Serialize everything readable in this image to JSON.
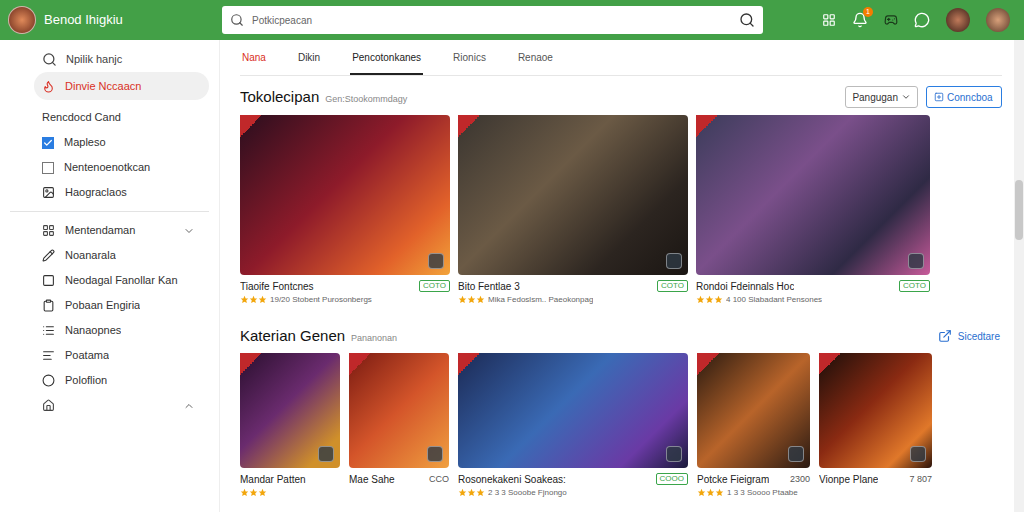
{
  "app": {
    "title": "Benod Ihigkiu"
  },
  "search": {
    "placeholder": "Potkicpeacan"
  },
  "notifications": {
    "count": "1"
  },
  "sidebar": {
    "items": [
      {
        "kind": "search",
        "label": "Npilik hanjc"
      },
      {
        "kind": "link",
        "label": "Dinvie Nccaacn",
        "selected": true
      },
      {
        "kind": "heading",
        "label": "Rencdocd Cand"
      },
      {
        "kind": "checkbox",
        "label": "Mapleso",
        "checked": true
      },
      {
        "kind": "checkbox",
        "label": "Nentenoenotkcan",
        "checked": false
      },
      {
        "kind": "link",
        "label": "Haograclaos",
        "selected": false
      },
      {
        "kind": "divider"
      },
      {
        "kind": "group",
        "label": "Mentendaman",
        "expanded": false
      },
      {
        "kind": "link",
        "label": "Noanarala",
        "selected": false
      },
      {
        "kind": "link",
        "label": "Neodagal Fanollar Kan",
        "selected": false
      },
      {
        "kind": "link",
        "label": "Pobaan Engiria",
        "selected": false
      },
      {
        "kind": "link",
        "label": "Nanaopnes",
        "selected": false
      },
      {
        "kind": "link",
        "label": "Poatama",
        "selected": false
      },
      {
        "kind": "link",
        "label": "Poloflion",
        "selected": false
      },
      {
        "kind": "group",
        "label": "",
        "expanded": true
      }
    ]
  },
  "tabs": [
    {
      "label": "Nana",
      "selected": false,
      "color": "#d93025"
    },
    {
      "label": "Dikin",
      "selected": false,
      "color": "#333333"
    },
    {
      "label": "Pencotonkanes",
      "selected": true,
      "color": "#222222"
    },
    {
      "label": "Rionics",
      "selected": false,
      "color": "#555555"
    },
    {
      "label": "Renaoe",
      "selected": false,
      "color": "#555555"
    }
  ],
  "sections": [
    {
      "title": "Tokolecipan",
      "subtitle": "Gen:Stookommdagy",
      "dropdown": "Pangugan",
      "button": "Conncboa",
      "link": "",
      "cards": [
        {
          "title": "Tiaoife Fontcnes",
          "price": "COTO",
          "kind": "badge",
          "stars": 3,
          "meta": "19/20 Stobent Purosonbergs"
        },
        {
          "title": "Bito Fentlae 3",
          "price": "COTO",
          "kind": "badge",
          "stars": 3,
          "meta": "Mika Fedoslsm.. Paeokonpag"
        },
        {
          "title": "Rondoi Fdeinnals Hoc",
          "price": "COTO",
          "kind": "badge",
          "stars": 3,
          "meta": "4 100 Slabadant Pensones"
        }
      ]
    },
    {
      "title": "Katerian Genen",
      "subtitle": "Pananonan",
      "dropdown": "",
      "button": "",
      "link": "Sicedtare",
      "cards": [
        {
          "title": "Mandar Patten",
          "price": "",
          "kind": "plain",
          "stars": 3,
          "meta": ""
        },
        {
          "title": "Mae Sahe",
          "price": "CCO",
          "kind": "plain",
          "stars": 0,
          "meta": ""
        },
        {
          "title": "Rosonekakeni Soakeas:",
          "price": "COOO",
          "kind": "badge",
          "stars": 3,
          "meta": "2 3 3 Sooobe Fjnongo"
        },
        {
          "title": "Potcke Fieigram",
          "price": "2300",
          "kind": "plain",
          "stars": 3,
          "meta": "1 3 3 Soooo Ptaabe"
        },
        {
          "title": "Vionpe Plane",
          "price": "7 807",
          "kind": "plain",
          "stars": 0,
          "meta": ""
        }
      ]
    }
  ]
}
